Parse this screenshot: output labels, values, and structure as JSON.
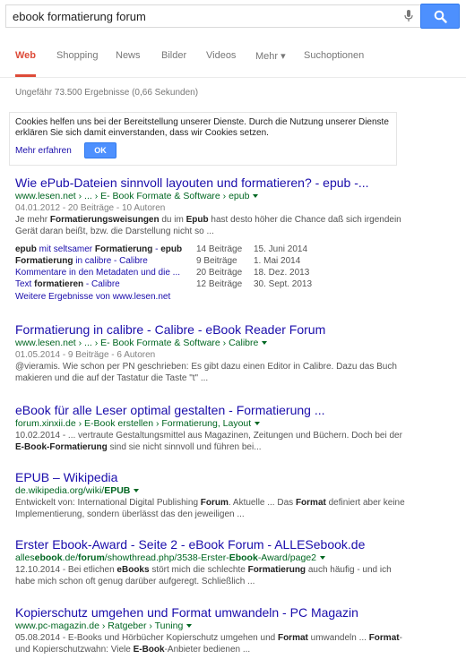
{
  "search": {
    "query": "ebook formatierung forum"
  },
  "tabs": [
    {
      "label": "Web"
    },
    {
      "label": "Shopping"
    },
    {
      "label": "News"
    },
    {
      "label": "Bilder"
    },
    {
      "label": "Videos"
    },
    {
      "label": "Mehr ▾"
    },
    {
      "label": "Suchoptionen"
    }
  ],
  "stats": "Ungefähr 73.500 Ergebnisse (0,66 Sekunden)",
  "cookie": {
    "text": "Cookies helfen uns bei der Bereitstellung unserer Dienste. Durch die Nutzung unserer Dienste erklären Sie sich damit einverstanden, dass wir Cookies setzen.",
    "link": "Mehr erfahren",
    "ok": "OK"
  },
  "results": [
    {
      "title": "Wie ePub-Dateien sinnvoll layouten und formatieren? - epub -...",
      "url": "www.lesen.net › ... › E- Book Formate & Software › epub",
      "meta": "04.01.2012 - 20 Beiträge - 10 Autoren",
      "snippet": "Je mehr <b>Formatierungsweisungen</b> du im <b>Epub</b> hast desto höher die Chance daß sich irgendein Gerät daran beißt, bzw. die Darstellung nicht so ..."
    },
    {
      "title": "Formatierung in calibre - Calibre - eBook Reader Forum",
      "url": "www.lesen.net › ... › E- Book Formate & Software › Calibre",
      "meta": "01.05.2014 - 9 Beiträge - 6 Autoren",
      "snippet": "@vieramis. Wie schon per PN geschrieben: Es gibt dazu einen Editor in Calibre. Dazu das Buch makieren und die auf der Tastatur die Taste \"t\" ..."
    },
    {
      "title": "eBook für alle Leser optimal gestalten - Formatierung ...",
      "url": "forum.xinxii.de › E-Book erstellen › Formatierung, Layout",
      "meta": "",
      "snippet": "10.02.2014 - ... vertraute Gestaltungsmittel aus Magazinen, Zeitungen und Büchern. Doch bei der <b>E-Book-Formatierung</b> sind sie nicht sinnvoll und führen bei..."
    },
    {
      "title": "EPUB – Wikipedia",
      "url": "de.wikipedia.org/wiki/<b>EPUB</b>",
      "meta": "",
      "snippet": "Entwickelt von: International Digital Publishing <b>Forum</b>. Aktuelle ... Das <b>Format</b> definiert aber keine Implementierung, sondern überlässt das den jeweiligen ..."
    },
    {
      "title": "Erster Ebook-Award - Seite 2 - eBook Forum - ALLESebook.de",
      "url": "alles<b>ebook</b>.de/<b>forum</b>/showthread.php/3538-Erster-<b>Ebook</b>-Award/page2",
      "meta": "",
      "snippet": "12.10.2014 - Bei etlichen <b>eBooks</b> stört mich die schlechte <b>Formatierung</b> auch häufig - und ich habe mich schon oft genug darüber aufgeregt. Schließlich ..."
    },
    {
      "title": "Kopierschutz umgehen und Format umwandeln - PC Magazin",
      "url": "www.pc-magazin.de › Ratgeber › Tuning",
      "meta": "",
      "snippet": "05.08.2014 - E-Books und Hörbücher Kopierschutz umgehen und <b>Format</b> umwandeln ... <b>Format</b>- und Kopierschutzwahn: Viele <b>E-Book</b>-Anbieter bedienen ..."
    }
  ],
  "sublinks": [
    {
      "title": "<b>epub</b> mit seltsamer <b>Formatierung</b> - <b>epub</b>",
      "count": "14 Beiträge",
      "date": "15. Juni 2014"
    },
    {
      "title": "<b>Formatierung</b> in calibre - Calibre",
      "count": "9 Beiträge",
      "date": "1. Mai 2014"
    },
    {
      "title": "Kommentare in den Metadaten und die ...",
      "count": "20 Beiträge",
      "date": "18. Dez. 2013"
    },
    {
      "title": "Text <b>formatieren</b> - Calibre",
      "count": "12 Beiträge",
      "date": "30. Sept. 2013"
    }
  ],
  "more_results": "Weitere Ergebnisse von www.lesen.net"
}
